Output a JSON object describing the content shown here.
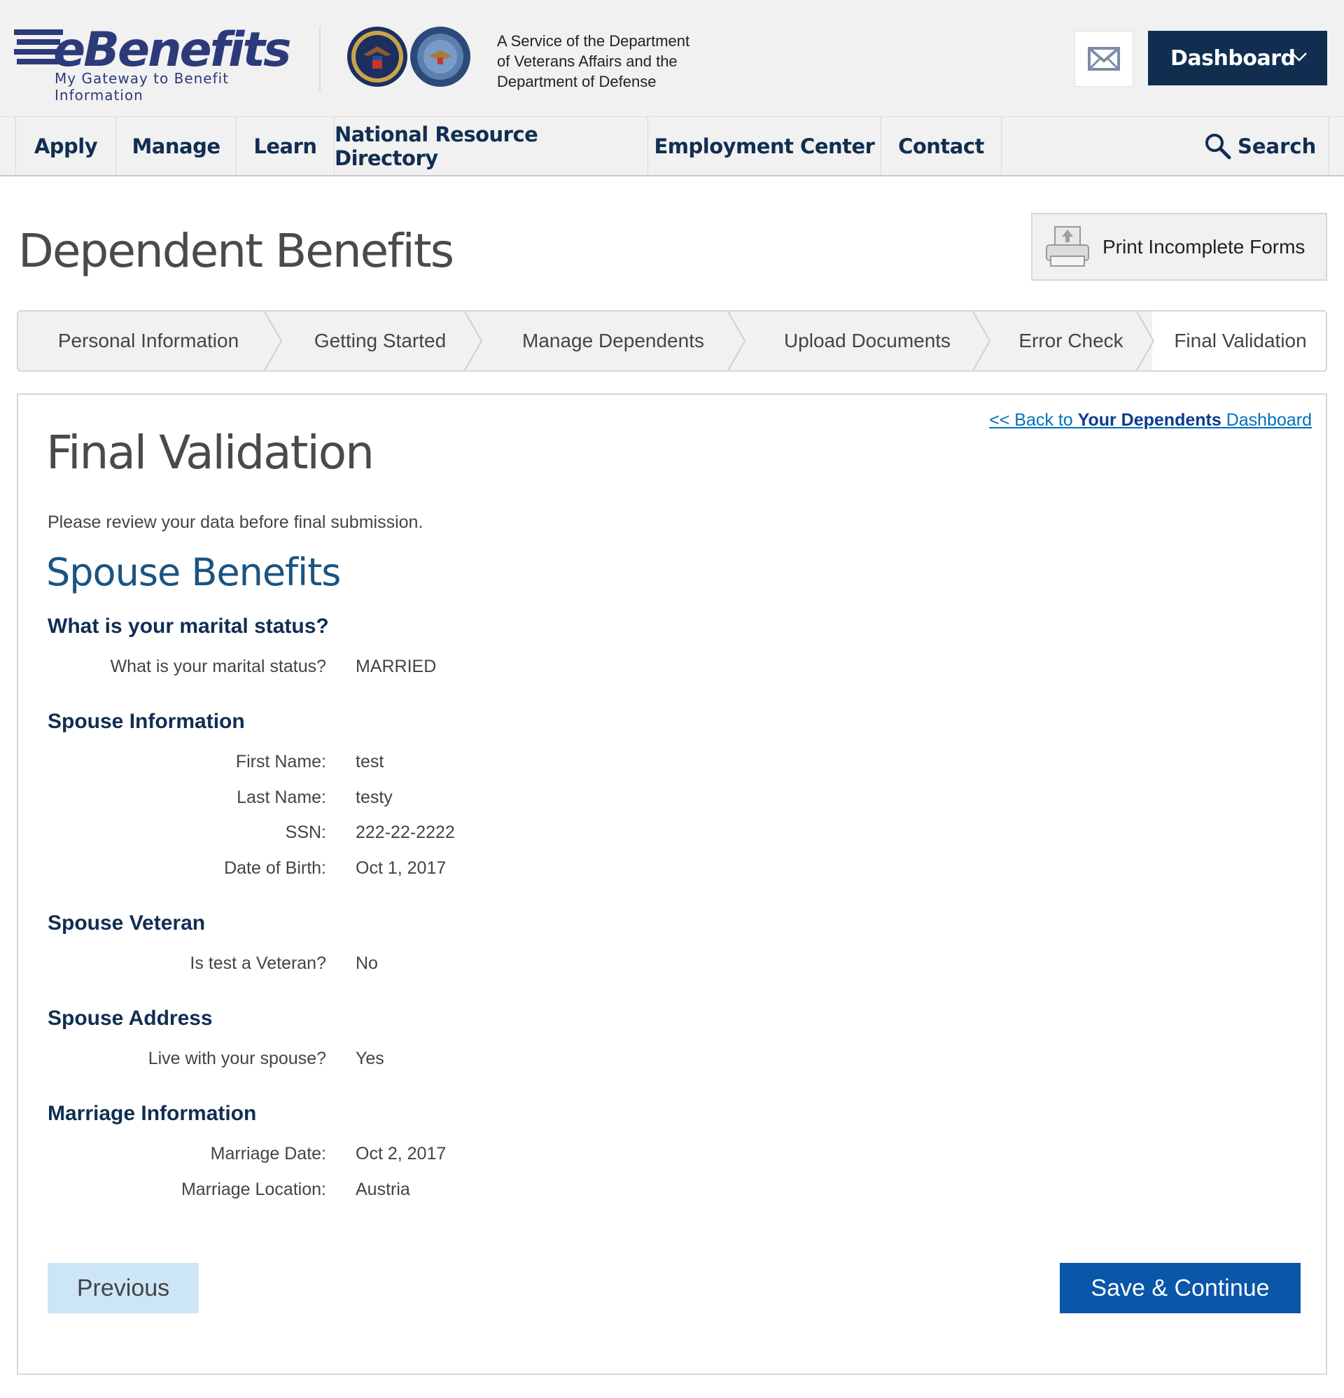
{
  "header": {
    "logo_text": "eBenefits",
    "logo_tagline": "My Gateway to Benefit Information",
    "service_line1": "A Service of the Department",
    "service_line2": "of Veterans Affairs and the",
    "service_line3": "Department of Defense",
    "dashboard_label": "Dashboard",
    "brand_color": "#112e51"
  },
  "nav": {
    "items": [
      "Apply",
      "Manage",
      "Learn",
      "National Resource Directory",
      "Employment Center",
      "Contact"
    ],
    "search_label": "Search"
  },
  "page": {
    "title": "Dependent Benefits",
    "print_label": "Print Incomplete Forms"
  },
  "steps": [
    {
      "label": "Personal Information",
      "active": false
    },
    {
      "label": "Getting Started",
      "active": false
    },
    {
      "label": "Manage Dependents",
      "active": false
    },
    {
      "label": "Upload Documents",
      "active": false
    },
    {
      "label": "Error Check",
      "active": false
    },
    {
      "label": "Final Validation",
      "active": true
    }
  ],
  "content": {
    "back_prefix": "<< Back to ",
    "back_bold": "Your Dependents",
    "back_suffix": " Dashboard",
    "title": "Final Validation",
    "intro": "Please review your data before final submission.",
    "spouse_heading": "Spouse Benefits",
    "sections": [
      {
        "heading": "What is your marital status?",
        "rows": [
          {
            "label": "What is your marital status?",
            "value": "MARRIED"
          }
        ]
      },
      {
        "heading": "Spouse Information",
        "rows": [
          {
            "label": "First Name:",
            "value": "test"
          },
          {
            "label": "Last Name:",
            "value": "testy"
          },
          {
            "label": "SSN:",
            "value": "222-22-2222"
          },
          {
            "label": "Date of Birth:",
            "value": "Oct 1, 2017"
          }
        ]
      },
      {
        "heading": "Spouse Veteran",
        "rows": [
          {
            "label": "Is test a Veteran?",
            "value": "No"
          }
        ]
      },
      {
        "heading": "Spouse Address",
        "rows": [
          {
            "label": "Live with your spouse?",
            "value": "Yes"
          }
        ]
      },
      {
        "heading": "Marriage Information",
        "rows": [
          {
            "label": "Marriage Date:",
            "value": "Oct 2, 2017"
          },
          {
            "label": "Marriage Location:",
            "value": "Austria"
          }
        ]
      }
    ],
    "previous_label": "Previous",
    "save_label": "Save & Continue"
  },
  "icons": {
    "mail": "mail-icon",
    "chevron": "chevron-down-icon",
    "search": "search-icon",
    "printer": "printer-icon"
  }
}
